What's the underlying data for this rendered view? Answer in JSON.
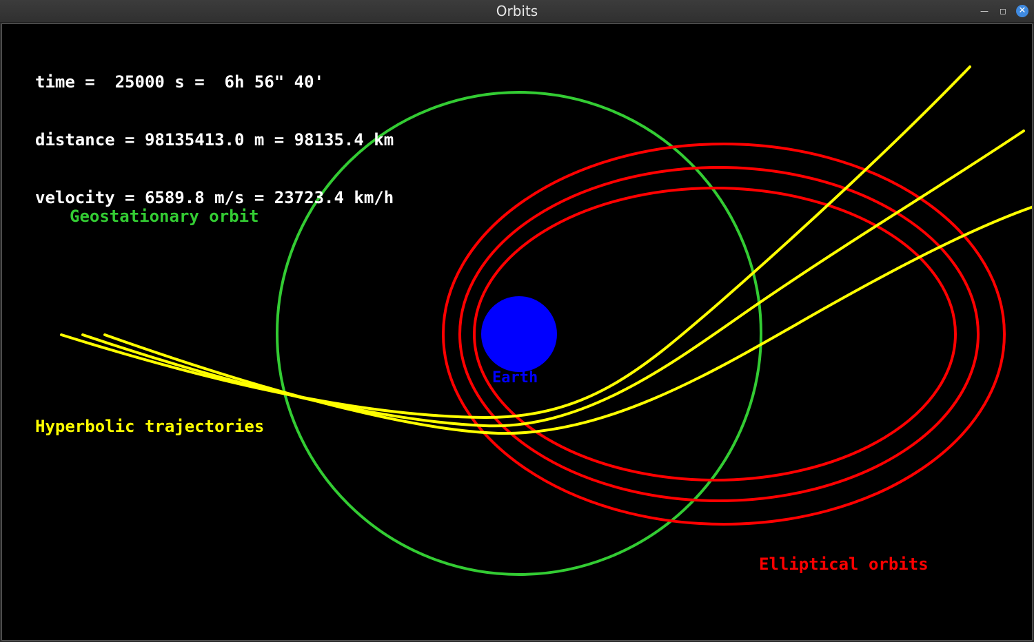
{
  "window": {
    "title": "Orbits",
    "controls": [
      "minimize",
      "maximize",
      "close"
    ]
  },
  "info": {
    "time": "time =  25000 s =  6h 56\" 40'",
    "distance": "distance = 98135413.0 m = 98135.4 km",
    "velocity": "velocity = 6589.8 m/s = 23723.4 km/h"
  },
  "labels": {
    "geostationary": "Geostationary orbit",
    "hyperbolic": "Hyperbolic trajectories",
    "elliptical": "Elliptical orbits",
    "earth": "Earth"
  },
  "colors": {
    "background": "#000000",
    "text": "#ffffff",
    "geostationary": "#33cc33",
    "elliptical": "#ff0000",
    "hyperbolic": "#ffff00",
    "earth": "#0000ff",
    "close_button": "#3f8ae0"
  },
  "icons": {
    "minimize": "minimize-icon",
    "maximize": "maximize-icon",
    "close": "close-icon"
  }
}
